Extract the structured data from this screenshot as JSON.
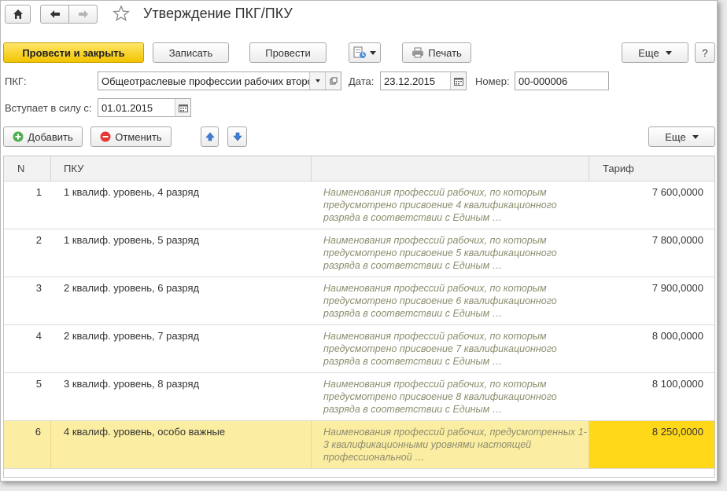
{
  "title": "Утверждение ПКГ/ПКУ",
  "toolbar": {
    "post_close": "Провести и закрыть",
    "save": "Записать",
    "post": "Провести",
    "print": "Печать",
    "more": "Еще",
    "help": "?"
  },
  "form": {
    "pkg_label": "ПКГ:",
    "pkg_value": "Общеотраслевые профессии рабочих второго",
    "date_label": "Дата:",
    "date_value": "23.12.2015",
    "number_label": "Номер:",
    "number_value": "00-000006",
    "effective_label": "Вступает в силу с:",
    "effective_value": "01.01.2015"
  },
  "table_toolbar": {
    "add": "Добавить",
    "cancel": "Отменить",
    "more": "Еще"
  },
  "table": {
    "headers": {
      "n": "N",
      "pku": "ПКУ",
      "desc": "",
      "tariff": "Тариф"
    },
    "rows": [
      {
        "n": "1",
        "pku": "1 квалиф. уровень, 4 разряд",
        "desc": "Наименования профессий рабочих, по которым предусмотрено присвоение 4 квалификационного разряда в соответствии с Единым …",
        "tariff": "7 600,0000"
      },
      {
        "n": "2",
        "pku": "1 квалиф. уровень, 5 разряд",
        "desc": "Наименования профессий рабочих, по которым предусмотрено присвоение 5 квалификационного разряда в соответствии с Единым …",
        "tariff": "7 800,0000"
      },
      {
        "n": "3",
        "pku": "2 квалиф. уровень, 6 разряд",
        "desc": "Наименования профессий рабочих, по которым предусмотрено присвоение 6 квалификационного разряда в соответствии с Единым …",
        "tariff": "7 900,0000"
      },
      {
        "n": "4",
        "pku": "2 квалиф. уровень, 7 разряд",
        "desc": "Наименования профессий рабочих, по которым предусмотрено присвоение 7 квалификационного разряда в соответствии с Единым …",
        "tariff": "8 000,0000"
      },
      {
        "n": "5",
        "pku": "3 квалиф. уровень, 8 разряд",
        "desc": "Наименования профессий рабочих, по которым предусмотрено присвоение 8 квалификационного разряда в соответствии с Единым …",
        "tariff": "8 100,0000"
      },
      {
        "n": "6",
        "pku": "4 квалиф. уровень, особо важные",
        "desc": "Наименования профессий рабочих, предусмотренных 1-3 квалификационными уровнями настоящей профессиональной …",
        "tariff": "8 250,0000"
      }
    ]
  },
  "colors": {
    "primary_button": "#f2c400",
    "selected_row": "#fbeda2",
    "selected_cell": "#ffd81a",
    "description_text": "#8d8d6f"
  },
  "icons": [
    "home-icon",
    "back-arrow-icon",
    "forward-arrow-icon",
    "star-icon",
    "document-structure-icon",
    "printer-icon",
    "dropdown-icon",
    "open-icon",
    "calendar-icon",
    "add-icon",
    "cancel-icon",
    "move-up-icon",
    "move-down-icon"
  ]
}
